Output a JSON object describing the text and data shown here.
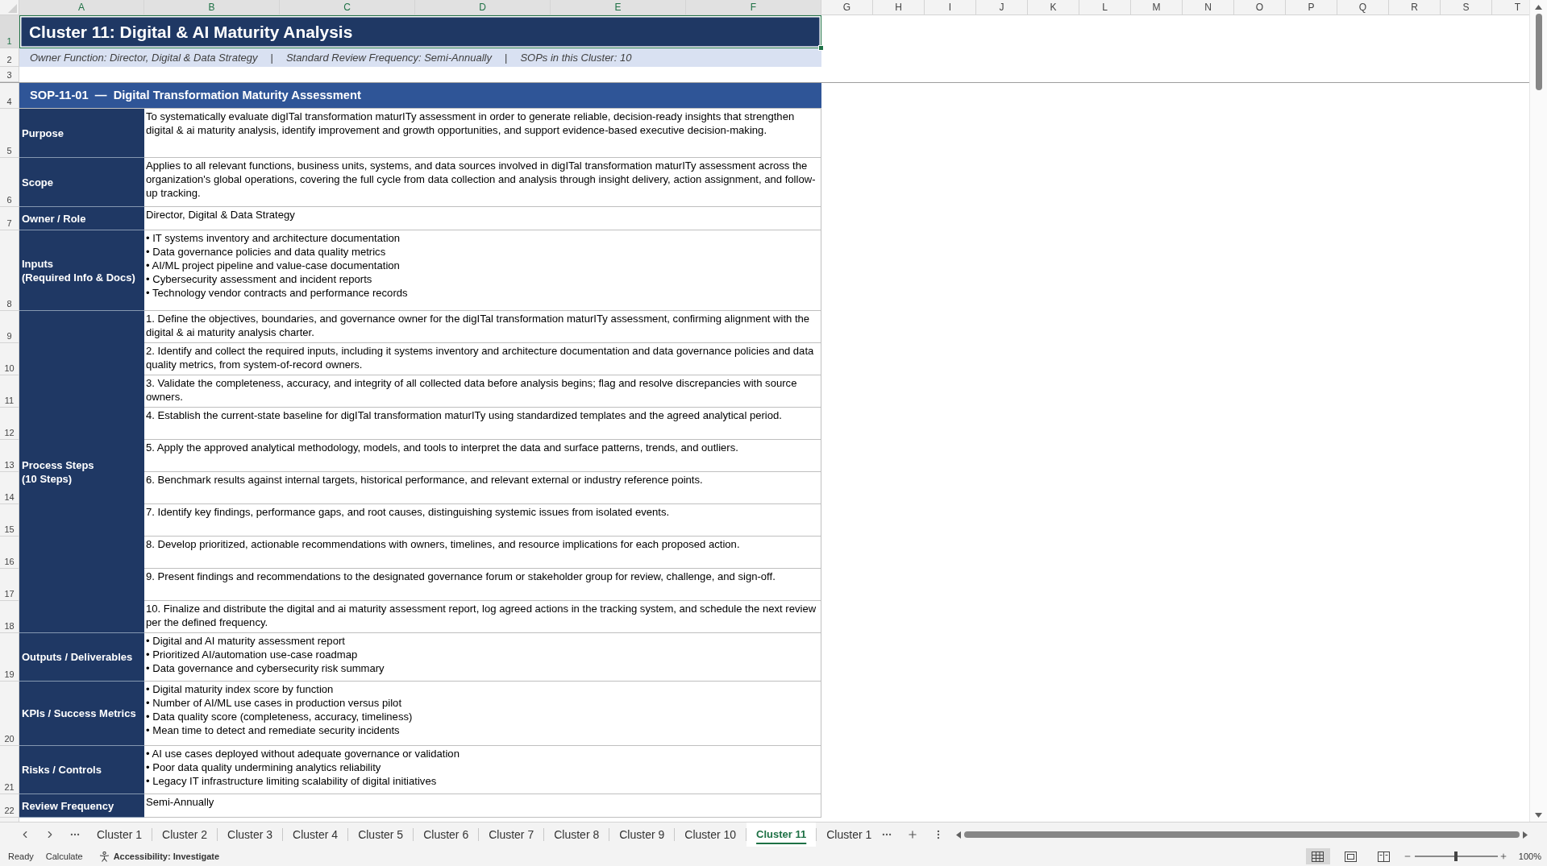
{
  "column_headers": [
    {
      "label": "A",
      "selected": true
    },
    {
      "label": "B",
      "selected": true
    },
    {
      "label": "C",
      "selected": true
    },
    {
      "label": "D",
      "selected": true
    },
    {
      "label": "E",
      "selected": true
    },
    {
      "label": "F",
      "selected": true
    },
    {
      "label": "G",
      "selected": false
    },
    {
      "label": "H",
      "selected": false
    },
    {
      "label": "I",
      "selected": false
    },
    {
      "label": "J",
      "selected": false
    },
    {
      "label": "K",
      "selected": false
    },
    {
      "label": "L",
      "selected": false
    },
    {
      "label": "M",
      "selected": false
    },
    {
      "label": "N",
      "selected": false
    },
    {
      "label": "O",
      "selected": false
    },
    {
      "label": "P",
      "selected": false
    },
    {
      "label": "Q",
      "selected": false
    },
    {
      "label": "R",
      "selected": false
    },
    {
      "label": "S",
      "selected": false
    },
    {
      "label": "T",
      "selected": false
    }
  ],
  "row_headers": [
    {
      "label": "1",
      "selected": true
    },
    {
      "label": "2",
      "selected": false
    },
    {
      "label": "3",
      "selected": false
    },
    {
      "label": "4",
      "selected": false
    },
    {
      "label": "5",
      "selected": false
    },
    {
      "label": "6",
      "selected": false
    },
    {
      "label": "7",
      "selected": false
    },
    {
      "label": "8",
      "selected": false
    },
    {
      "label": "9",
      "selected": false
    },
    {
      "label": "10",
      "selected": false
    },
    {
      "label": "11",
      "selected": false
    },
    {
      "label": "12",
      "selected": false
    },
    {
      "label": "13",
      "selected": false
    },
    {
      "label": "14",
      "selected": false
    },
    {
      "label": "15",
      "selected": false
    },
    {
      "label": "16",
      "selected": false
    },
    {
      "label": "17",
      "selected": false
    },
    {
      "label": "18",
      "selected": false
    },
    {
      "label": "19",
      "selected": false
    },
    {
      "label": "20",
      "selected": false
    },
    {
      "label": "21",
      "selected": false
    },
    {
      "label": "22",
      "selected": false
    }
  ],
  "title": {
    "text": "Cluster 11: Digital & AI Maturity Analysis",
    "selected": true
  },
  "info": [
    {
      "kind": "field",
      "text": "Owner Function: Director, Digital & Data Strategy"
    },
    {
      "kind": "separator",
      "text": "|"
    },
    {
      "kind": "field",
      "text": "Standard Review Frequency: Semi-Annually"
    },
    {
      "kind": "separator",
      "text": "|"
    },
    {
      "kind": "field",
      "text": "SOPs in this Cluster: 10"
    }
  ],
  "sop": {
    "header": "SOP-11-01  —  Digital Transformation Maturity Assessment",
    "sections": [
      {
        "kind": "text",
        "label": "Purpose",
        "text": "To systematically evaluate digITal transformation maturITy assessment in order to generate reliable, decision-ready insights that strengthen digital & ai maturity analysis, identify improvement and growth opportunities, and support evidence-based executive decision-making."
      },
      {
        "kind": "text",
        "label": "Scope",
        "text": "Applies to all relevant functions, business units, systems, and data sources involved in digITal transformation maturITy assessment across the organization's global operations, covering the full cycle from data collection and analysis through insight delivery, action assignment, and follow-up tracking."
      },
      {
        "kind": "text",
        "label": "Owner / Role",
        "text": "Director, Digital & Data Strategy"
      },
      {
        "kind": "bullets",
        "label": "Inputs\n(Required Info & Docs)",
        "items": [
          "• IT systems inventory and architecture documentation",
          "• Data governance policies and data quality metrics",
          "• AI/ML project pipeline and value-case documentation",
          "• Cybersecurity assessment and incident reports",
          "• Technology vendor contracts and performance records"
        ]
      },
      {
        "kind": "steps",
        "label": "Process Steps\n(10 Steps)",
        "items": [
          "1. Define the objectives, boundaries, and governance owner for the digITal transformation maturITy assessment, confirming alignment with the digital & ai maturity analysis charter.",
          "2. Identify and collect the required inputs, including it systems inventory and architecture documentation and data governance policies and data quality metrics, from system-of-record owners.",
          "3. Validate the completeness, accuracy, and integrity of all collected data before analysis begins; flag and resolve discrepancies with source owners.",
          "4. Establish the current-state baseline for digITal transformation maturITy using standardized templates and the agreed analytical period.",
          "5. Apply the approved analytical methodology, models, and tools to interpret the data and surface patterns, trends, and outliers.",
          "6. Benchmark results against internal targets, historical performance, and relevant external or industry reference points.",
          "7. Identify key findings, performance gaps, and root causes, distinguishing systemic issues from isolated events.",
          "8. Develop prioritized, actionable recommendations with owners, timelines, and resource implications for each proposed action.",
          "9. Present findings and recommendations to the designated governance forum or stakeholder group for review, challenge, and sign-off.",
          "10. Finalize and distribute the digital and ai maturity assessment report, log agreed actions in the tracking system, and schedule the next review per the defined frequency."
        ]
      },
      {
        "kind": "bullets",
        "label": "Outputs / Deliverables",
        "items": [
          "• Digital and AI maturity assessment report",
          "• Prioritized AI/automation use-case roadmap",
          "• Data governance and cybersecurity risk summary"
        ]
      },
      {
        "kind": "bullets",
        "label": "KPIs / Success Metrics",
        "items": [
          "• Digital maturity index score by function",
          "• Number of AI/ML use cases in production versus pilot",
          "• Data quality score (completeness, accuracy, timeliness)",
          "• Mean time to detect and remediate security incidents"
        ]
      },
      {
        "kind": "bullets",
        "label": "Risks / Controls",
        "items": [
          "• AI use cases deployed without adequate governance or validation",
          "• Poor data quality undermining analytics reliability",
          "• Legacy IT infrastructure limiting scalability of digital initiatives"
        ]
      },
      {
        "kind": "text",
        "label": "Review Frequency",
        "text": "Semi-Annually"
      }
    ]
  },
  "sheet_tabs": [
    {
      "label": "Cluster 1",
      "selected": false
    },
    {
      "label": "Cluster 2",
      "selected": false
    },
    {
      "label": "Cluster 3",
      "selected": false
    },
    {
      "label": "Cluster 4",
      "selected": false
    },
    {
      "label": "Cluster 5",
      "selected": false
    },
    {
      "label": "Cluster 6",
      "selected": false
    },
    {
      "label": "Cluster 7",
      "selected": false
    },
    {
      "label": "Cluster 8",
      "selected": false
    },
    {
      "label": "Cluster 9",
      "selected": false
    },
    {
      "label": "Cluster 10",
      "selected": false
    },
    {
      "label": "Cluster 11",
      "selected": true
    },
    {
      "label": "Cluster 1",
      "selected": false
    }
  ],
  "status_bar": {
    "mode": "Ready",
    "calculate": "Calculate",
    "accessibility": "Accessibility: Investigate",
    "views": [
      {
        "kind": "normal",
        "selected": true
      },
      {
        "kind": "page_layout",
        "selected": false
      },
      {
        "kind": "page_break",
        "selected": false
      }
    ],
    "zoom": {
      "level": 0.5,
      "reading": "100%"
    }
  }
}
